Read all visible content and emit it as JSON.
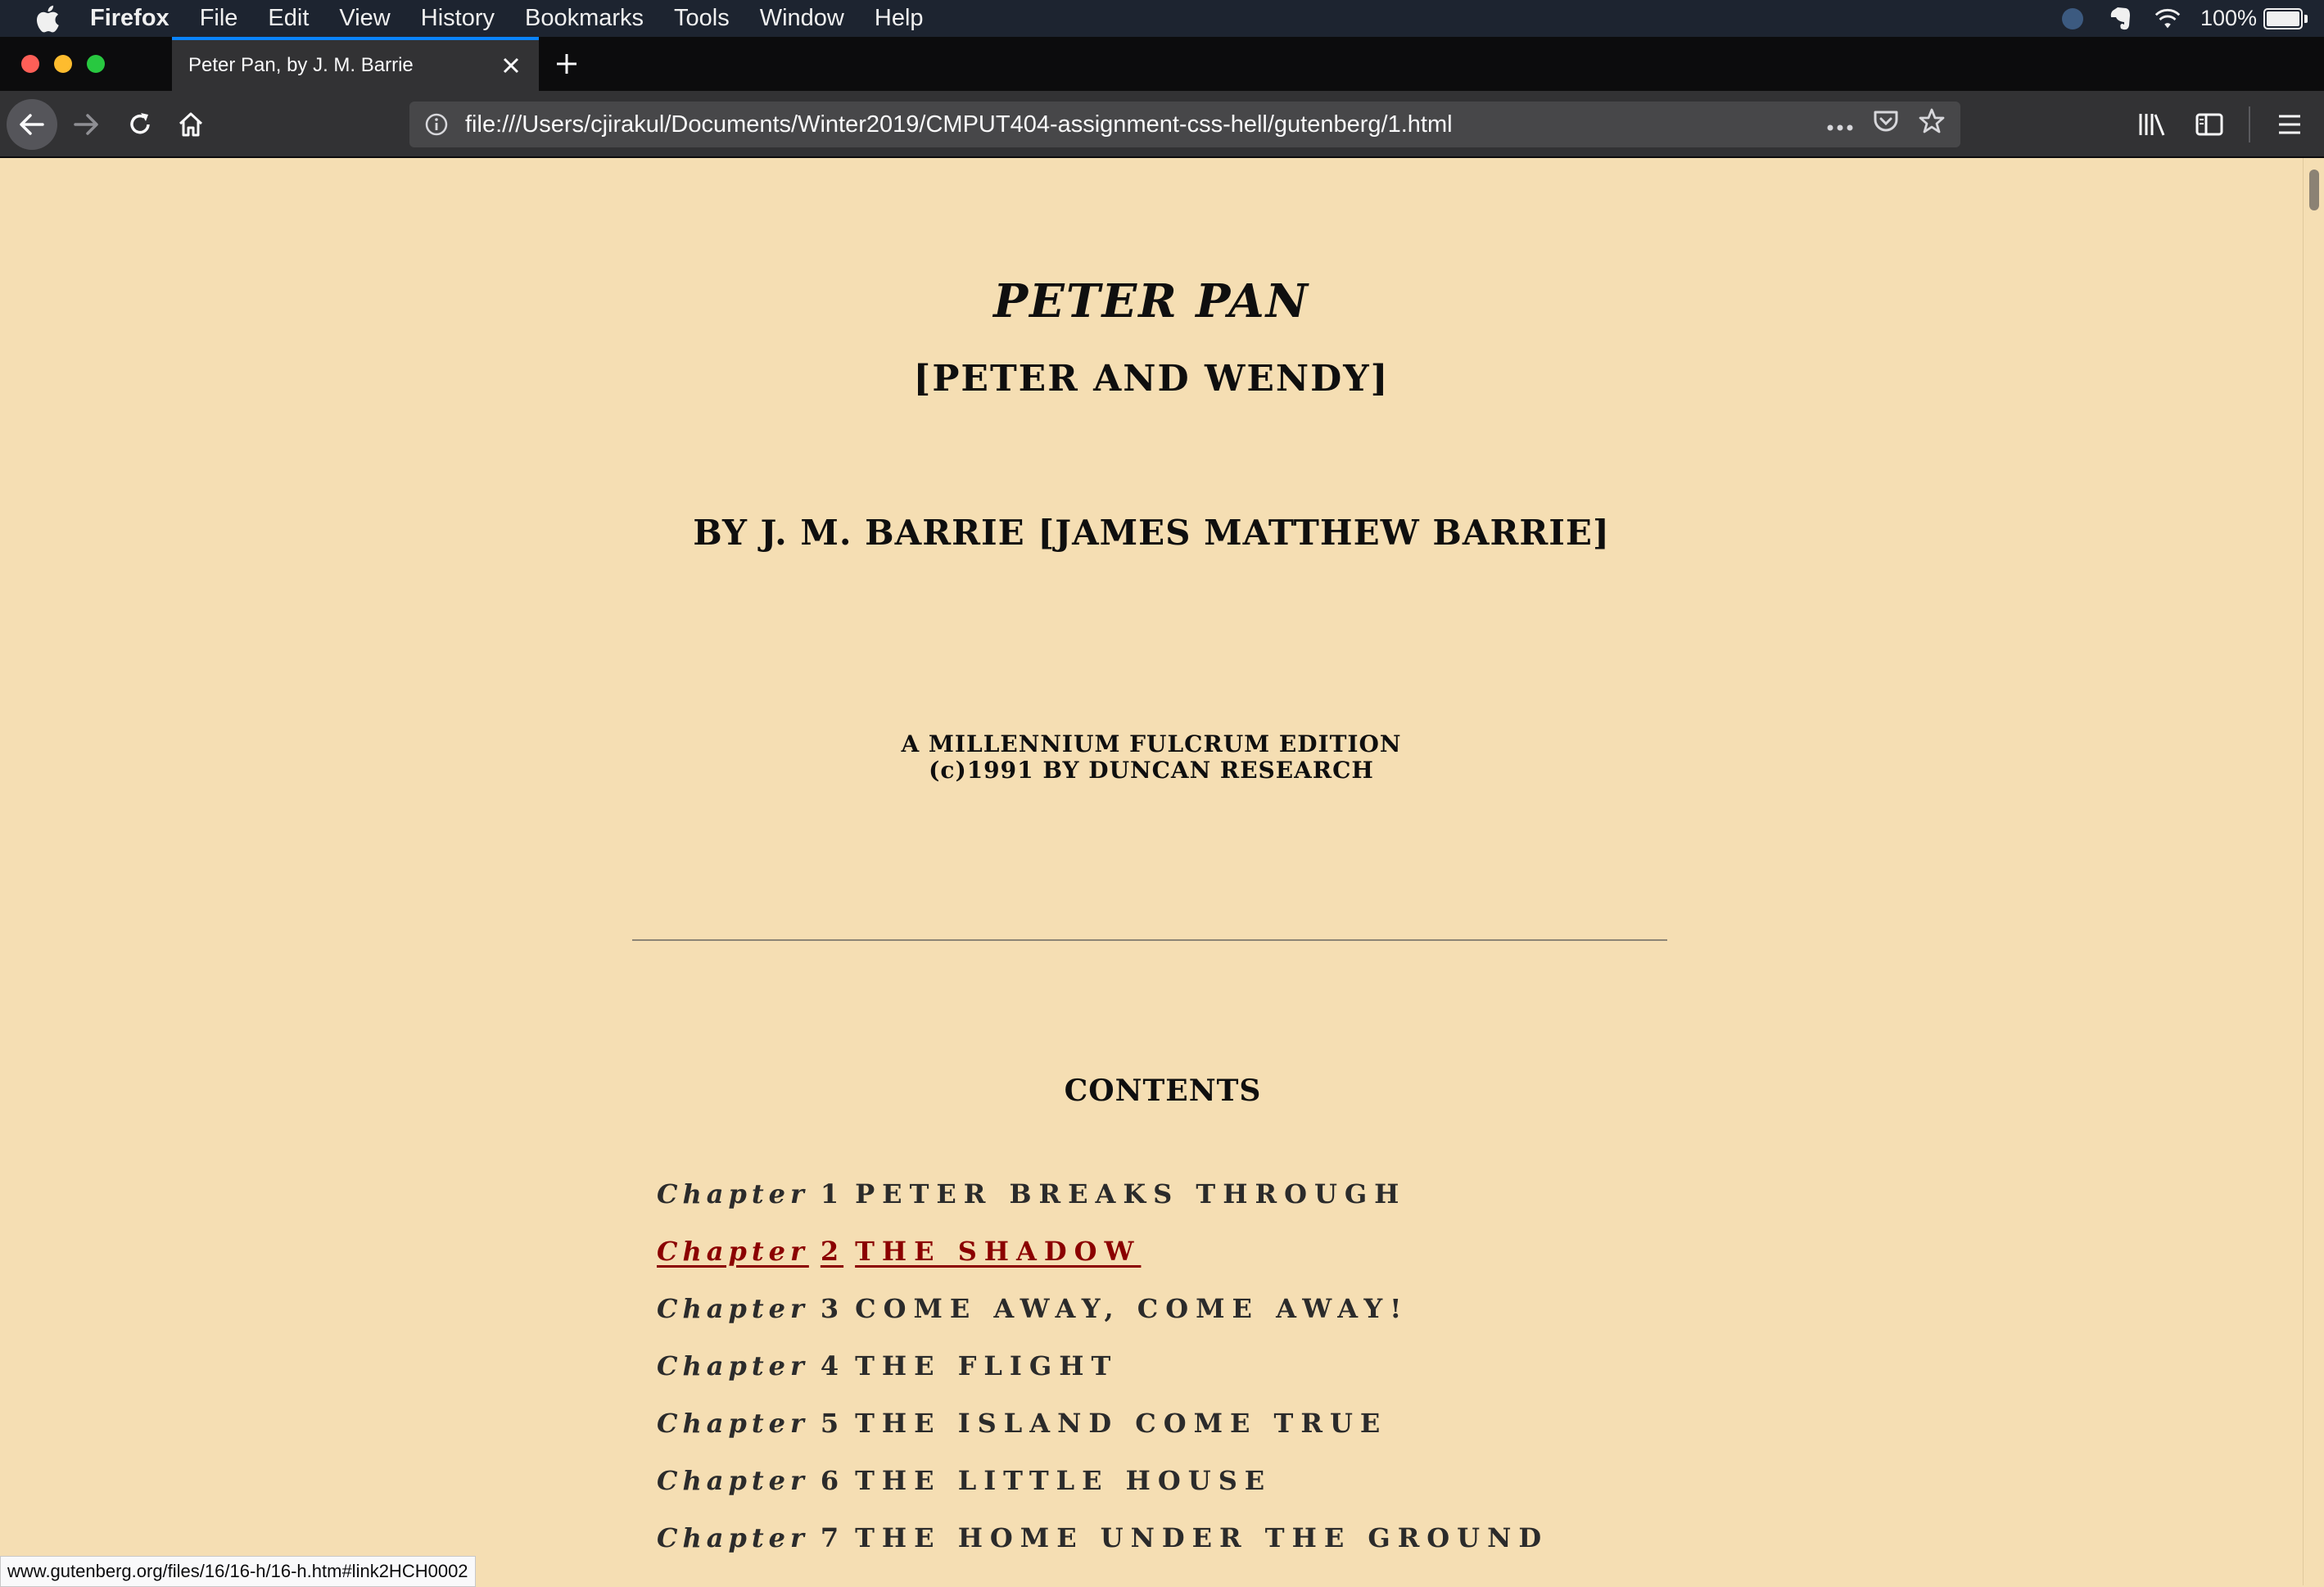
{
  "menubar": {
    "app_name": "Firefox",
    "items": [
      "File",
      "Edit",
      "View",
      "History",
      "Bookmarks",
      "Tools",
      "Window",
      "Help"
    ],
    "battery_text": "100%",
    "battery_level": 1.0
  },
  "tab": {
    "title": "Peter Pan, by J. M. Barrie"
  },
  "navbar": {
    "url": "file:///Users/cjirakul/Documents/Winter2019/CMPUT404-assignment-css-hell/gutenberg/1.html"
  },
  "page": {
    "title": "PETER PAN",
    "subtitle": "[PETER AND WENDY]",
    "author": "BY J. M. BARRIE [JAMES MATTHEW BARRIE]",
    "edition_line1": "A MILLENNIUM FULCRUM EDITION",
    "edition_line2": "(c)1991 BY DUNCAN RESEARCH",
    "contents_heading": "CONTENTS",
    "chapters": [
      {
        "label": "Chapter",
        "number": "1",
        "name": "PETER BREAKS THROUGH"
      },
      {
        "label": "Chapter",
        "number": "2",
        "name": "THE SHADOW"
      },
      {
        "label": "Chapter",
        "number": "3",
        "name": "COME AWAY, COME AWAY!"
      },
      {
        "label": "Chapter",
        "number": "4",
        "name": "THE FLIGHT"
      },
      {
        "label": "Chapter",
        "number": "5",
        "name": "THE ISLAND COME TRUE"
      },
      {
        "label": "Chapter",
        "number": "6",
        "name": "THE LITTLE HOUSE"
      },
      {
        "label": "Chapter",
        "number": "7",
        "name": "THE HOME UNDER THE GROUND"
      }
    ]
  },
  "statusbar": {
    "link": "www.gutenberg.org/files/16/16-h/16-h.htm#link2HCH0002"
  },
  "colors": {
    "page_background": "#f5deb3",
    "link_hover": "#8b0000",
    "toolbar": "#323234"
  }
}
